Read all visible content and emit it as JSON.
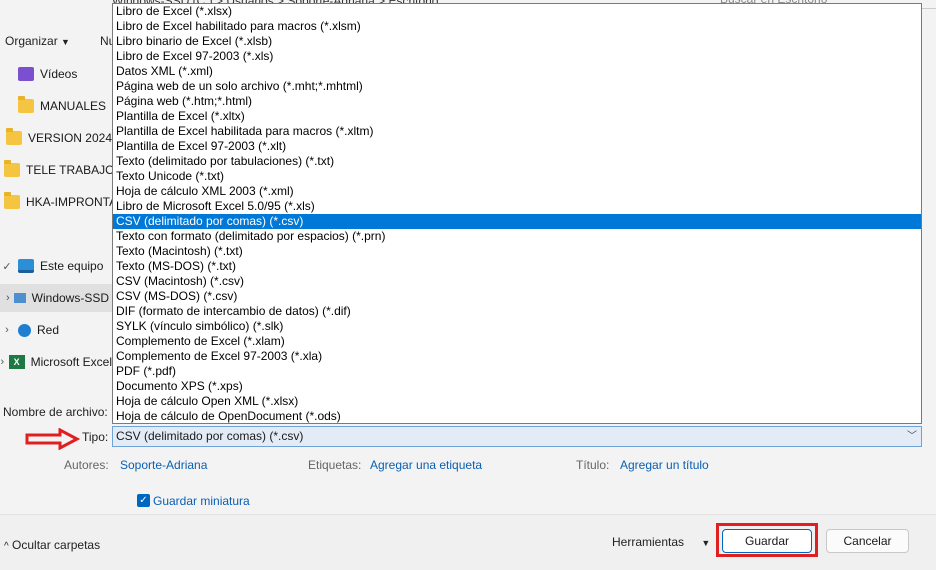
{
  "breadcrumb": "Windows-SSD (C:)  >  Usuarios  >  Soporte-Adriana  >  Escritorio",
  "search_placeholder": "Buscar en Escritorio",
  "toolbar": {
    "organize": "Organizar",
    "new_folder": "Nu"
  },
  "nav": {
    "quick": [
      {
        "label": "Vídeos",
        "icon": "video-folder-icon"
      },
      {
        "label": "MANUALES",
        "icon": "folder-icon"
      },
      {
        "label": "VERSION 2024",
        "icon": "folder-icon"
      },
      {
        "label": "TELE TRABAJO",
        "icon": "folder-icon"
      },
      {
        "label": "HKA-IMPRONTA",
        "icon": "folder-icon"
      }
    ],
    "this_pc": "Este equipo",
    "drive": "Windows-SSD (C:)",
    "network": "Red",
    "excel": "Microsoft Excel"
  },
  "file_types": [
    "Libro de Excel (*.xlsx)",
    "Libro de Excel habilitado para macros (*.xlsm)",
    "Libro binario de Excel (*.xlsb)",
    "Libro de Excel 97-2003 (*.xls)",
    "Datos XML (*.xml)",
    "Página web de un solo archivo (*.mht;*.mhtml)",
    "Página web (*.htm;*.html)",
    "Plantilla de Excel (*.xltx)",
    "Plantilla de Excel habilitada para macros (*.xltm)",
    "Plantilla de Excel 97-2003 (*.xlt)",
    "Texto (delimitado por tabulaciones) (*.txt)",
    "Texto Unicode (*.txt)",
    "Hoja de cálculo XML 2003 (*.xml)",
    "Libro de Microsoft Excel 5.0/95 (*.xls)",
    "CSV (delimitado por comas) (*.csv)",
    "Texto con formato (delimitado por espacios) (*.prn)",
    "Texto (Macintosh) (*.txt)",
    "Texto (MS-DOS) (*.txt)",
    "CSV (Macintosh) (*.csv)",
    "CSV (MS-DOS) (*.csv)",
    "DIF (formato de intercambio de datos) (*.dif)",
    "SYLK (vínculo simbólico) (*.slk)",
    "Complemento de Excel (*.xlam)",
    "Complemento de Excel 97-2003 (*.xla)",
    "PDF (*.pdf)",
    "Documento XPS (*.xps)",
    "Hoja de cálculo Open XML (*.xlsx)",
    "Hoja de cálculo de OpenDocument (*.ods)"
  ],
  "selected_index": 14,
  "form": {
    "filename_label": "Nombre de archivo:",
    "type_label": "Tipo:",
    "type_value": "CSV (delimitado por comas) (*.csv)",
    "authors_label": "Autores:",
    "authors_value": "Soporte-Adriana",
    "tags_label": "Etiquetas:",
    "tags_value": "Agregar una etiqueta",
    "title_label": "Título:",
    "title_value": "Agregar un título",
    "thumbnail_label": "Guardar miniatura"
  },
  "footer": {
    "hide_folders": "Ocultar carpetas",
    "tools": "Herramientas",
    "save": "Guardar",
    "cancel": "Cancelar"
  },
  "colors": {
    "accent": "#0078d7",
    "highlight": "#e02020"
  }
}
